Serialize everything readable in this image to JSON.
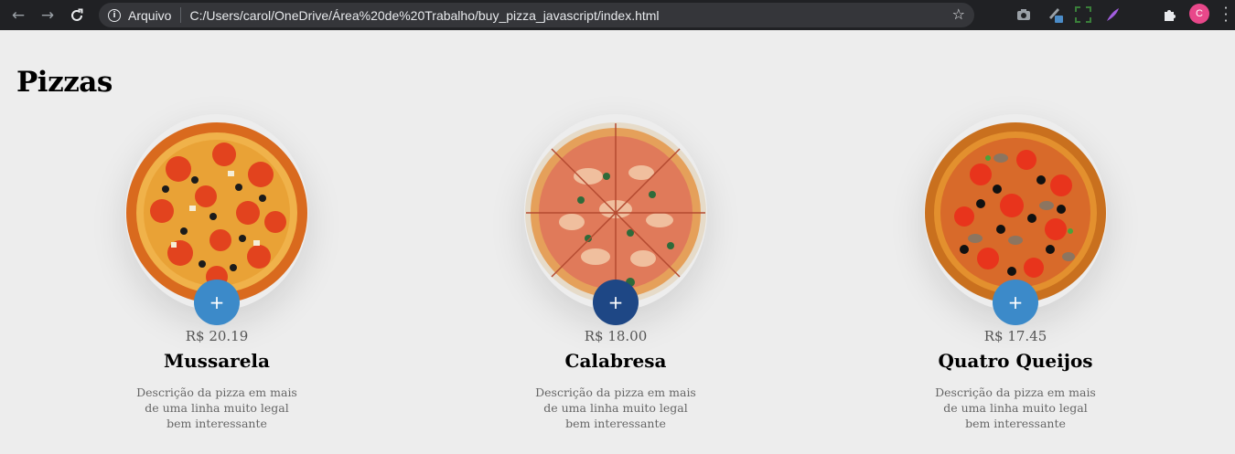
{
  "browser": {
    "scheme_label": "Arquivo",
    "url": "C:/Users/carol/OneDrive/Área%20de%20Trabalho/buy_pizza_javascript/index.html",
    "profile_initial": "C",
    "profile_color": "#e8488a",
    "icons": [
      "back-arrow-icon",
      "forward-arrow-icon",
      "reload-icon",
      "info-icon",
      "star-icon",
      "camera-icon",
      "pen-icon",
      "screen-capture-icon",
      "feather-icon",
      "puzzle-icon",
      "more-vert-icon"
    ]
  },
  "page": {
    "title": "Pizzas"
  },
  "pizzas": [
    {
      "price": "R$ 20.19",
      "name": "Mussarela",
      "description": "Descrição da pizza em mais de uma linha muito legal bem interessante",
      "add_label": "+",
      "button_color": "#3c8ac9"
    },
    {
      "price": "R$ 18.00",
      "name": "Calabresa",
      "description": "Descrição da pizza em mais de uma linha muito legal bem interessante",
      "add_label": "+",
      "button_color": "#1e4785"
    },
    {
      "price": "R$ 17.45",
      "name": "Quatro Queijos",
      "description": "Descrição da pizza em mais de uma linha muito legal bem interessante",
      "add_label": "+",
      "button_color": "#3c8ac9"
    }
  ]
}
